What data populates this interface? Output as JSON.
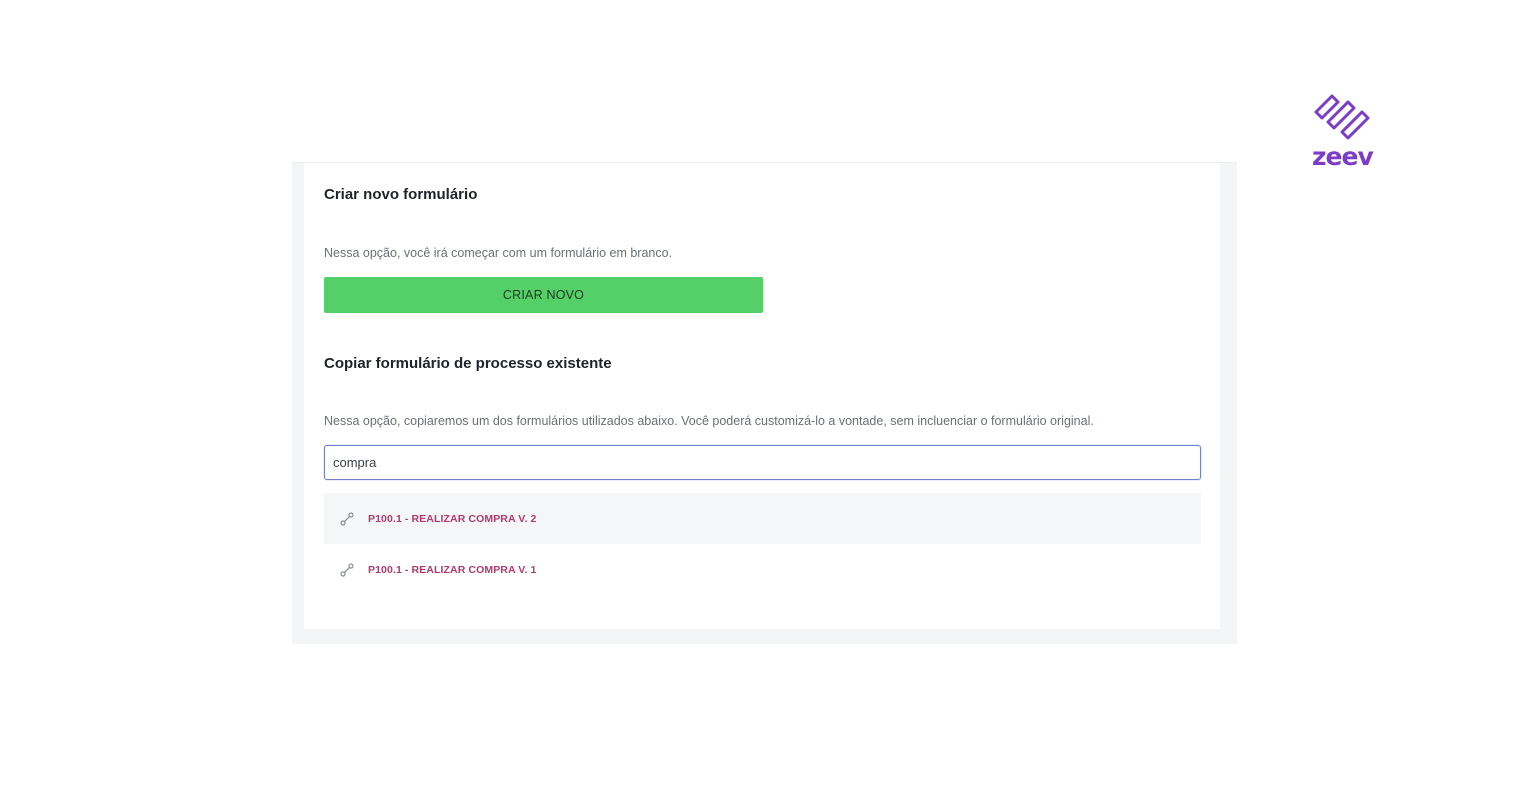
{
  "brand": {
    "name": "zeev",
    "color": "#7d3cc7"
  },
  "create_section": {
    "title": "Criar novo formulário",
    "description": "Nessa opção, você irá começar com um formulário em branco.",
    "button_label": "CRIAR NOVO",
    "button_color": "#55cf67"
  },
  "copy_section": {
    "title": "Copiar formulário de processo existente",
    "description": "Nessa opção, copiaremos um dos formulários utilizados abaixo. Você poderá customizá-lo a vontade, sem incluenciar o formulário original.",
    "search_value": "compra",
    "results": [
      {
        "label": "P100.1 - REALIZAR COMPRA V. 2",
        "icon": "process-flow-icon",
        "highlighted": true
      },
      {
        "label": "P100.1 - REALIZAR COMPRA V. 1",
        "icon": "process-flow-icon",
        "highlighted": false
      }
    ],
    "result_color": "#b23a6c"
  }
}
